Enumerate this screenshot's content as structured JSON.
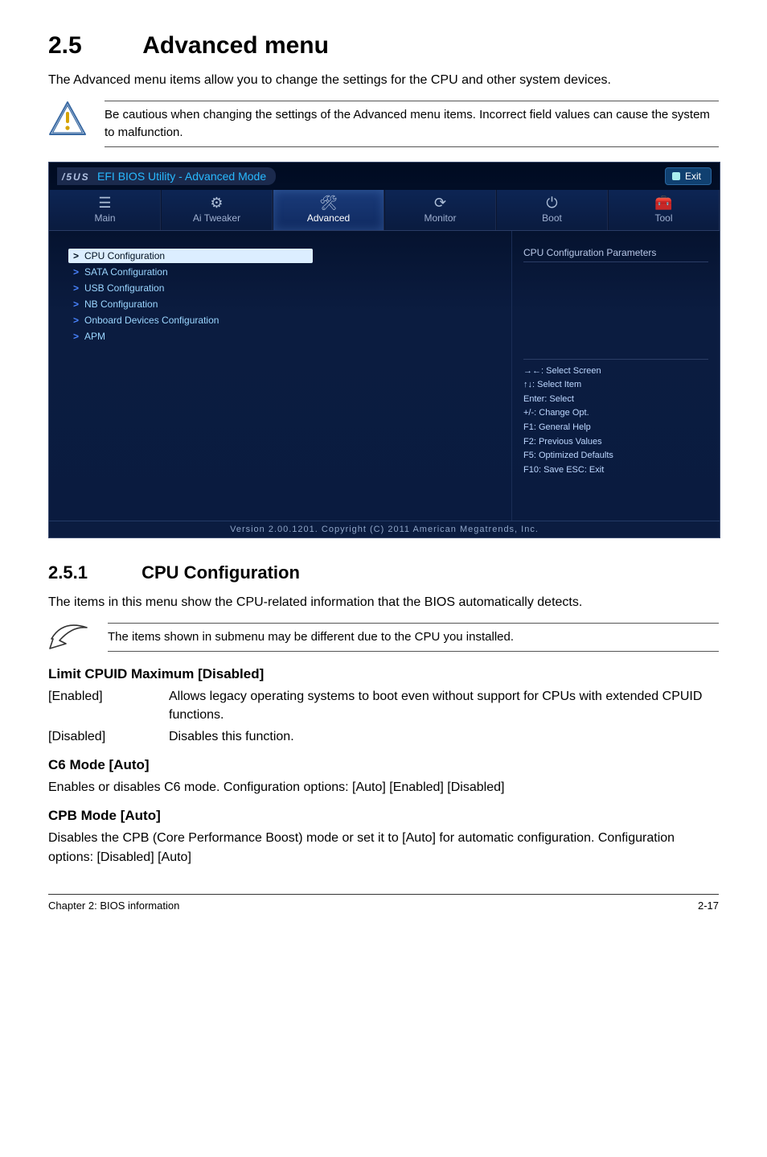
{
  "section": {
    "num": "2.5",
    "title": "Advanced menu"
  },
  "intro": "The Advanced menu items allow you to change the settings for the CPU and other system devices.",
  "warning": "Be cautious when changing the settings of the Advanced menu items. Incorrect field values can cause the system to malfunction.",
  "bios": {
    "brand": "/5US",
    "title": "EFI BIOS Utility - Advanced Mode",
    "exit": "Exit",
    "tabs": [
      {
        "label": "Main",
        "icon": "☰"
      },
      {
        "label": "Ai Tweaker",
        "icon": "⚙"
      },
      {
        "label": "Advanced",
        "icon": "🛠"
      },
      {
        "label": "Monitor",
        "icon": "⟳"
      },
      {
        "label": "Boot",
        "icon": "⏻"
      },
      {
        "label": "Tool",
        "icon": "🧰"
      }
    ],
    "menu": [
      {
        "label": "CPU Configuration",
        "selected": true
      },
      {
        "label": "SATA Configuration"
      },
      {
        "label": "USB Configuration"
      },
      {
        "label": "NB Configuration"
      },
      {
        "label": "Onboard Devices Configuration"
      },
      {
        "label": "APM"
      }
    ],
    "right_title": "CPU Configuration Parameters",
    "help": [
      "→←: Select Screen",
      "↑↓: Select Item",
      "Enter: Select",
      "+/-: Change Opt.",
      "F1: General Help",
      "F2: Previous Values",
      "F5: Optimized Defaults",
      "F10: Save   ESC: Exit"
    ],
    "footer": "Version 2.00.1201.   Copyright (C) 2011 American Megatrends, Inc."
  },
  "subsection": {
    "num": "2.5.1",
    "title": "CPU Configuration"
  },
  "sub_intro": "The items in this menu show the CPU-related information that the BIOS automatically detects.",
  "note": "The items shown in submenu may be different due to the CPU you installed.",
  "options": {
    "limit_cpuid": {
      "heading": "Limit CPUID Maximum [Disabled]",
      "rows": [
        {
          "k": "[Enabled]",
          "v": "Allows legacy operating systems to boot even without support for CPUs with extended CPUID functions."
        },
        {
          "k": "[Disabled]",
          "v": "Disables this function."
        }
      ]
    },
    "c6": {
      "heading": "C6 Mode [Auto]",
      "text": "Enables or disables C6 mode. Configuration options: [Auto] [Enabled] [Disabled]"
    },
    "cpb": {
      "heading": "CPB Mode [Auto]",
      "text": "Disables the CPB (Core Performance Boost) mode or set it to [Auto] for automatic configuration. Configuration options: [Disabled] [Auto]"
    }
  },
  "footer": {
    "left": "Chapter 2: BIOS information",
    "right": "2-17"
  }
}
